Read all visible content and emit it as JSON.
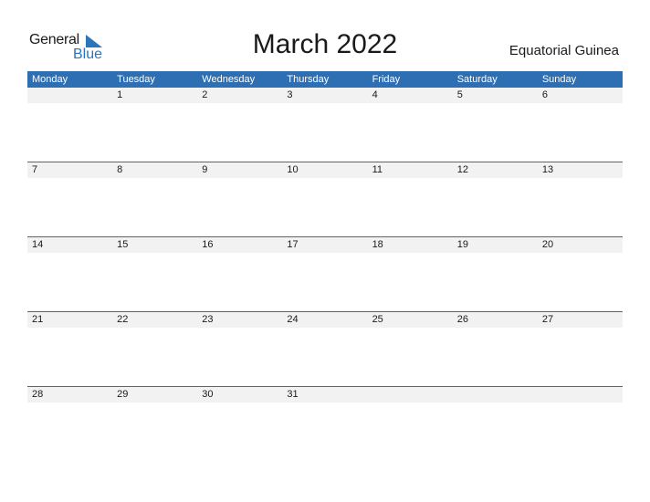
{
  "logo": {
    "word1": "General",
    "word2": "Blue",
    "accent": "#2a75bb"
  },
  "title": "March 2022",
  "country": "Equatorial Guinea",
  "colors": {
    "header_bg": "#2e6fb3",
    "row_bg": "#f2f2f2"
  },
  "weekdays": [
    "Monday",
    "Tuesday",
    "Wednesday",
    "Thursday",
    "Friday",
    "Saturday",
    "Sunday"
  ],
  "weeks": [
    [
      "",
      "1",
      "2",
      "3",
      "4",
      "5",
      "6"
    ],
    [
      "7",
      "8",
      "9",
      "10",
      "11",
      "12",
      "13"
    ],
    [
      "14",
      "15",
      "16",
      "17",
      "18",
      "19",
      "20"
    ],
    [
      "21",
      "22",
      "23",
      "24",
      "25",
      "26",
      "27"
    ],
    [
      "28",
      "29",
      "30",
      "31",
      "",
      "",
      ""
    ]
  ]
}
